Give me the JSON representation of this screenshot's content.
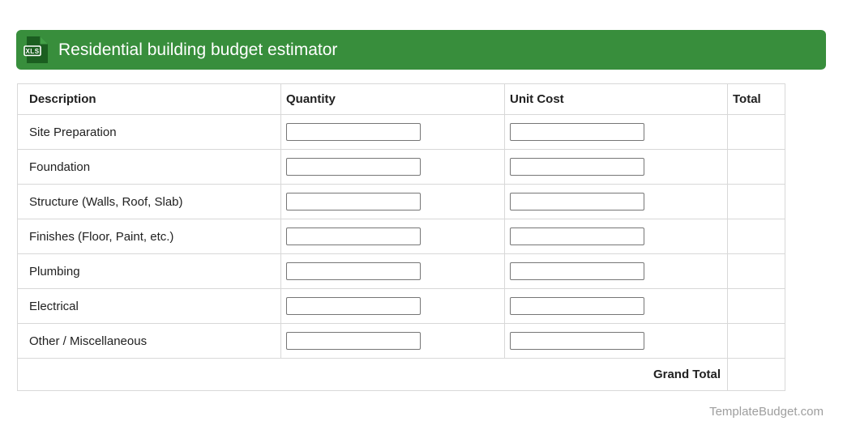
{
  "header": {
    "title": "Residential building budget estimator",
    "icon_label": "XLS",
    "bar_color": "#388e3c",
    "icon_color": "#1b5e20"
  },
  "table": {
    "columns": [
      {
        "label": "Description"
      },
      {
        "label": "Quantity"
      },
      {
        "label": "Unit Cost"
      },
      {
        "label": "Total"
      }
    ],
    "rows": [
      {
        "description": "Site Preparation",
        "quantity": "",
        "unit_cost": "",
        "total": ""
      },
      {
        "description": "Foundation",
        "quantity": "",
        "unit_cost": "",
        "total": ""
      },
      {
        "description": "Structure (Walls, Roof, Slab)",
        "quantity": "",
        "unit_cost": "",
        "total": ""
      },
      {
        "description": "Finishes (Floor, Paint, etc.)",
        "quantity": "",
        "unit_cost": "",
        "total": ""
      },
      {
        "description": "Plumbing",
        "quantity": "",
        "unit_cost": "",
        "total": ""
      },
      {
        "description": "Electrical",
        "quantity": "",
        "unit_cost": "",
        "total": ""
      },
      {
        "description": "Other / Miscellaneous",
        "quantity": "",
        "unit_cost": "",
        "total": ""
      }
    ],
    "grand_total": {
      "label": "Grand Total",
      "value": ""
    }
  },
  "footer": {
    "credit": "TemplateBudget.com"
  }
}
